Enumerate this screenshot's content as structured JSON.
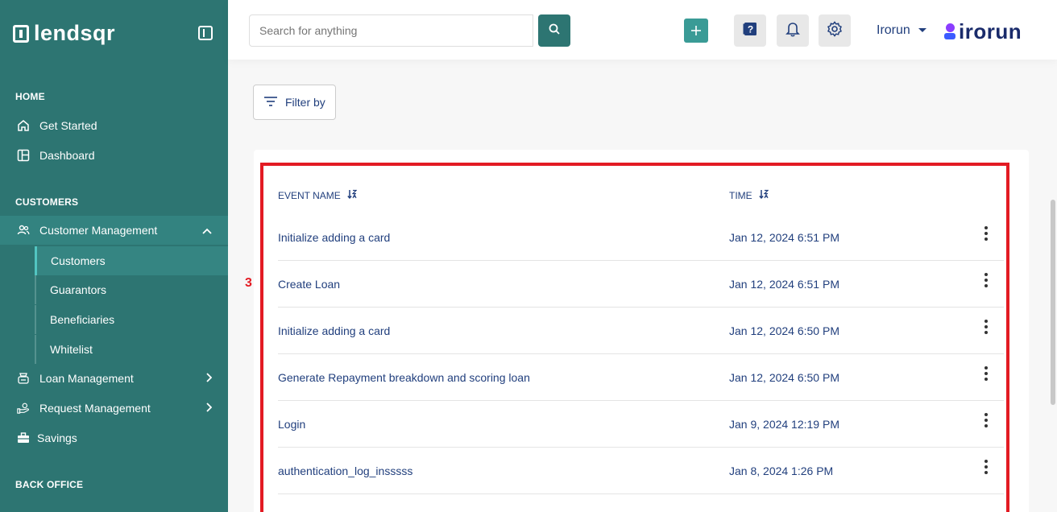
{
  "sidebar": {
    "logo_text": "lendsqr",
    "sections": {
      "home": "HOME",
      "customers": "CUSTOMERS",
      "back_office": "BACK OFFICE"
    },
    "items": {
      "get_started": "Get Started",
      "dashboard": "Dashboard",
      "customer_management": "Customer Management",
      "loan_management": "Loan Management",
      "request_management": "Request Management",
      "savings": "Savings"
    },
    "sub_items": [
      "Customers",
      "Guarantors",
      "Beneficiaries",
      "Whitelist"
    ]
  },
  "topbar": {
    "search_placeholder": "Search for anything",
    "user_name": "Irorun",
    "brand_text": "irorun"
  },
  "filter": {
    "label": "Filter by"
  },
  "table": {
    "columns": {
      "event_name": "EVENT NAME",
      "time": "TIME"
    },
    "rows": [
      {
        "name": "Initialize adding a card",
        "time": "Jan 12, 2024 6:51 PM"
      },
      {
        "name": "Create Loan",
        "time": "Jan 12, 2024 6:51 PM"
      },
      {
        "name": "Initialize adding a card",
        "time": "Jan 12, 2024 6:50 PM"
      },
      {
        "name": "Generate Repayment breakdown and scoring loan",
        "time": "Jan 12, 2024 6:50 PM"
      },
      {
        "name": "Login",
        "time": "Jan 9, 2024 12:19 PM"
      },
      {
        "name": "authentication_log_insssss",
        "time": "Jan 8, 2024 1:26 PM"
      }
    ]
  },
  "annotation": {
    "marker": "3"
  },
  "colors": {
    "sidebar": "#2d7572",
    "accent": "#3a9b96",
    "text": "#213f7d",
    "highlight": "#e31b23"
  }
}
